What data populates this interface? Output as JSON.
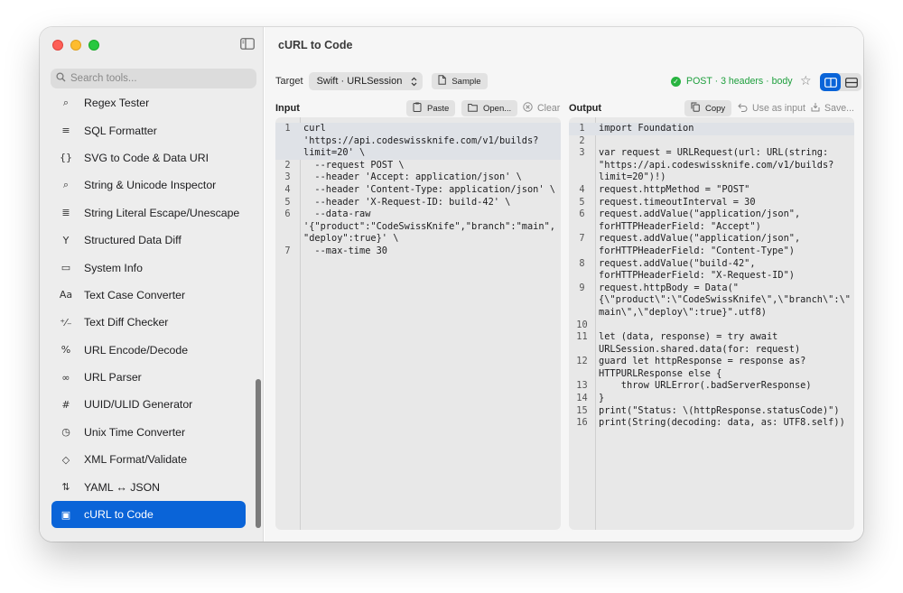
{
  "window": {
    "title": "cURL to Code"
  },
  "sidebar": {
    "search_placeholder": "Search tools...",
    "items": [
      {
        "label": "Regex Tester",
        "icon": "magnifier-regex-icon"
      },
      {
        "label": "SQL Formatter",
        "icon": "lines-icon"
      },
      {
        "label": "SVG to Code & Data URI",
        "icon": "braces-icon"
      },
      {
        "label": "String & Unicode Inspector",
        "icon": "magnifier-icon"
      },
      {
        "label": "String Literal Escape/Unescape",
        "icon": "text-format-icon"
      },
      {
        "label": "Structured Data Diff",
        "icon": "fork-icon"
      },
      {
        "label": "System Info",
        "icon": "display-icon"
      },
      {
        "label": "Text Case Converter",
        "icon": "text-case-icon"
      },
      {
        "label": "Text Diff Checker",
        "icon": "plus-minus-icon"
      },
      {
        "label": "URL Encode/Decode",
        "icon": "percent-icon"
      },
      {
        "label": "URL Parser",
        "icon": "link-icon"
      },
      {
        "label": "UUID/ULID Generator",
        "icon": "number-square-icon"
      },
      {
        "label": "Unix Time Converter",
        "icon": "clock-icon"
      },
      {
        "label": "XML Format/Validate",
        "icon": "tag-icon"
      },
      {
        "label": "YAML ↔ JSON",
        "icon": "swap-icon"
      },
      {
        "label": "cURL to Code",
        "icon": "terminal-icon",
        "active": true
      }
    ]
  },
  "toolbar": {
    "target_label": "Target",
    "target_value": "Swift · URLSession",
    "sample_label": "Sample",
    "status_text": "POST · 3 headers · body",
    "status_color": "#1e9f3d"
  },
  "input": {
    "title": "Input",
    "paste_label": "Paste",
    "open_label": "Open...",
    "clear_label": "Clear",
    "lines": [
      {
        "n": "1",
        "t": "curl"
      },
      {
        "n": "",
        "t": "'https://api.codeswissknife.com/v1/builds?"
      },
      {
        "n": "",
        "t": "limit=20' \\"
      },
      {
        "n": "2",
        "t": "  --request POST \\"
      },
      {
        "n": "3",
        "t": "  --header 'Accept: application/json' \\"
      },
      {
        "n": "4",
        "t": "  --header 'Content-Type: application/json' \\"
      },
      {
        "n": "5",
        "t": "  --header 'X-Request-ID: build-42' \\"
      },
      {
        "n": "6",
        "t": "  --data-raw"
      },
      {
        "n": "",
        "t": "'{\"product\":\"CodeSwissKnife\",\"branch\":\"main\","
      },
      {
        "n": "",
        "t": "\"deploy\":true}' \\"
      },
      {
        "n": "7",
        "t": "  --max-time 30"
      }
    ]
  },
  "output": {
    "title": "Output",
    "copy_label": "Copy",
    "use_as_input_label": "Use as input",
    "save_label": "Save...",
    "lines": [
      {
        "n": "1",
        "t": "import Foundation"
      },
      {
        "n": "2",
        "t": ""
      },
      {
        "n": "3",
        "t": "var request = URLRequest(url: URL(string:"
      },
      {
        "n": "",
        "t": "\"https://api.codeswissknife.com/v1/builds?"
      },
      {
        "n": "",
        "t": "limit=20\")!)"
      },
      {
        "n": "4",
        "t": "request.httpMethod = \"POST\""
      },
      {
        "n": "5",
        "t": "request.timeoutInterval = 30"
      },
      {
        "n": "6",
        "t": "request.addValue(\"application/json\","
      },
      {
        "n": "",
        "t": "forHTTPHeaderField: \"Accept\")"
      },
      {
        "n": "7",
        "t": "request.addValue(\"application/json\","
      },
      {
        "n": "",
        "t": "forHTTPHeaderField: \"Content-Type\")"
      },
      {
        "n": "8",
        "t": "request.addValue(\"build-42\","
      },
      {
        "n": "",
        "t": "forHTTPHeaderField: \"X-Request-ID\")"
      },
      {
        "n": "9",
        "t": "request.httpBody = Data(\""
      },
      {
        "n": "",
        "t": "{\\\"product\\\":\\\"CodeSwissKnife\\\",\\\"branch\\\":\\\""
      },
      {
        "n": "",
        "t": "main\\\",\\\"deploy\\\":true}\".utf8)"
      },
      {
        "n": "10",
        "t": ""
      },
      {
        "n": "11",
        "t": "let (data, response) = try await"
      },
      {
        "n": "",
        "t": "URLSession.shared.data(for: request)"
      },
      {
        "n": "12",
        "t": "guard let httpResponse = response as?"
      },
      {
        "n": "",
        "t": "HTTPURLResponse else {"
      },
      {
        "n": "13",
        "t": "    throw URLError(.badServerResponse)"
      },
      {
        "n": "14",
        "t": "}"
      },
      {
        "n": "15",
        "t": "print(\"Status: \\(httpResponse.statusCode)\")"
      },
      {
        "n": "16",
        "t": "print(String(decoding: data, as: UTF8.self))"
      }
    ]
  }
}
